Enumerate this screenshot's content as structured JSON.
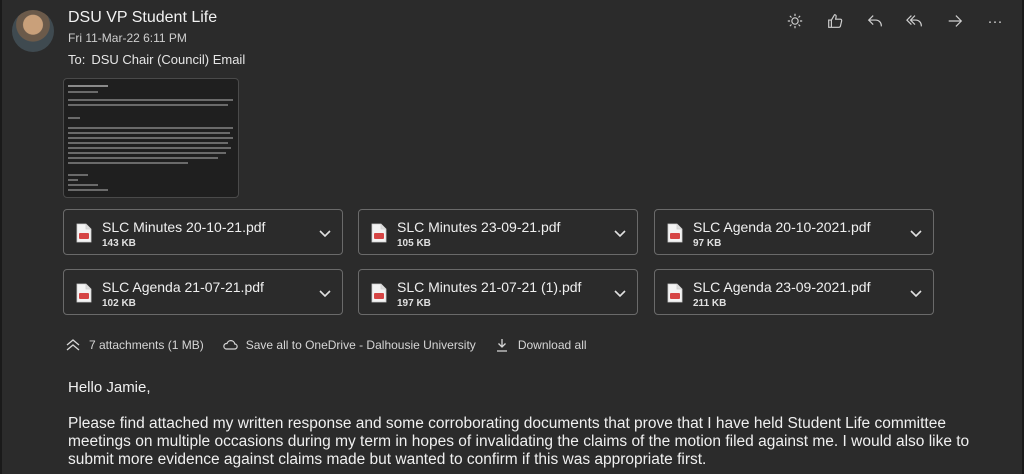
{
  "header": {
    "sender": "DSU VP Student Life",
    "date": "Fri 11-Mar-22 6:11 PM",
    "to_label": "To:",
    "to_value": "DSU Chair (Council) Email"
  },
  "toolbar": {
    "icons": [
      "sun-icon",
      "like-icon",
      "reply-icon",
      "reply-all-icon",
      "forward-icon",
      "more-icon"
    ],
    "more_glyph": "···"
  },
  "attachments": [
    {
      "name": "SLC Minutes 20-10-21.pdf",
      "size": "143 KB"
    },
    {
      "name": "SLC Minutes 23-09-21.pdf",
      "size": "105 KB"
    },
    {
      "name": "SLC Agenda 20-10-2021.pdf",
      "size": "97 KB"
    },
    {
      "name": "SLC Agenda 21-07-21.pdf",
      "size": "102 KB"
    },
    {
      "name": "SLC Minutes 21-07-21 (1).pdf",
      "size": "197 KB"
    },
    {
      "name": "SLC Agenda 23-09-2021.pdf",
      "size": "211 KB"
    }
  ],
  "actions": {
    "count": "7 attachments (1 MB)",
    "save_all": "Save all to OneDrive - Dalhousie University",
    "download_all": "Download all"
  },
  "message": {
    "greeting": "Hello Jamie,",
    "paragraph": "Please find attached my written response and some corroborating documents that prove that I have held Student Life committee meetings on multiple occasions during my term in hopes of invalidating the claims of the motion filed against me. I would also like to submit more evidence against claims made but wanted to confirm if this was appropriate first."
  },
  "colors": {
    "background": "#2b2b2b",
    "pdf_red": "#d64545",
    "border": "#6a6a6a"
  }
}
